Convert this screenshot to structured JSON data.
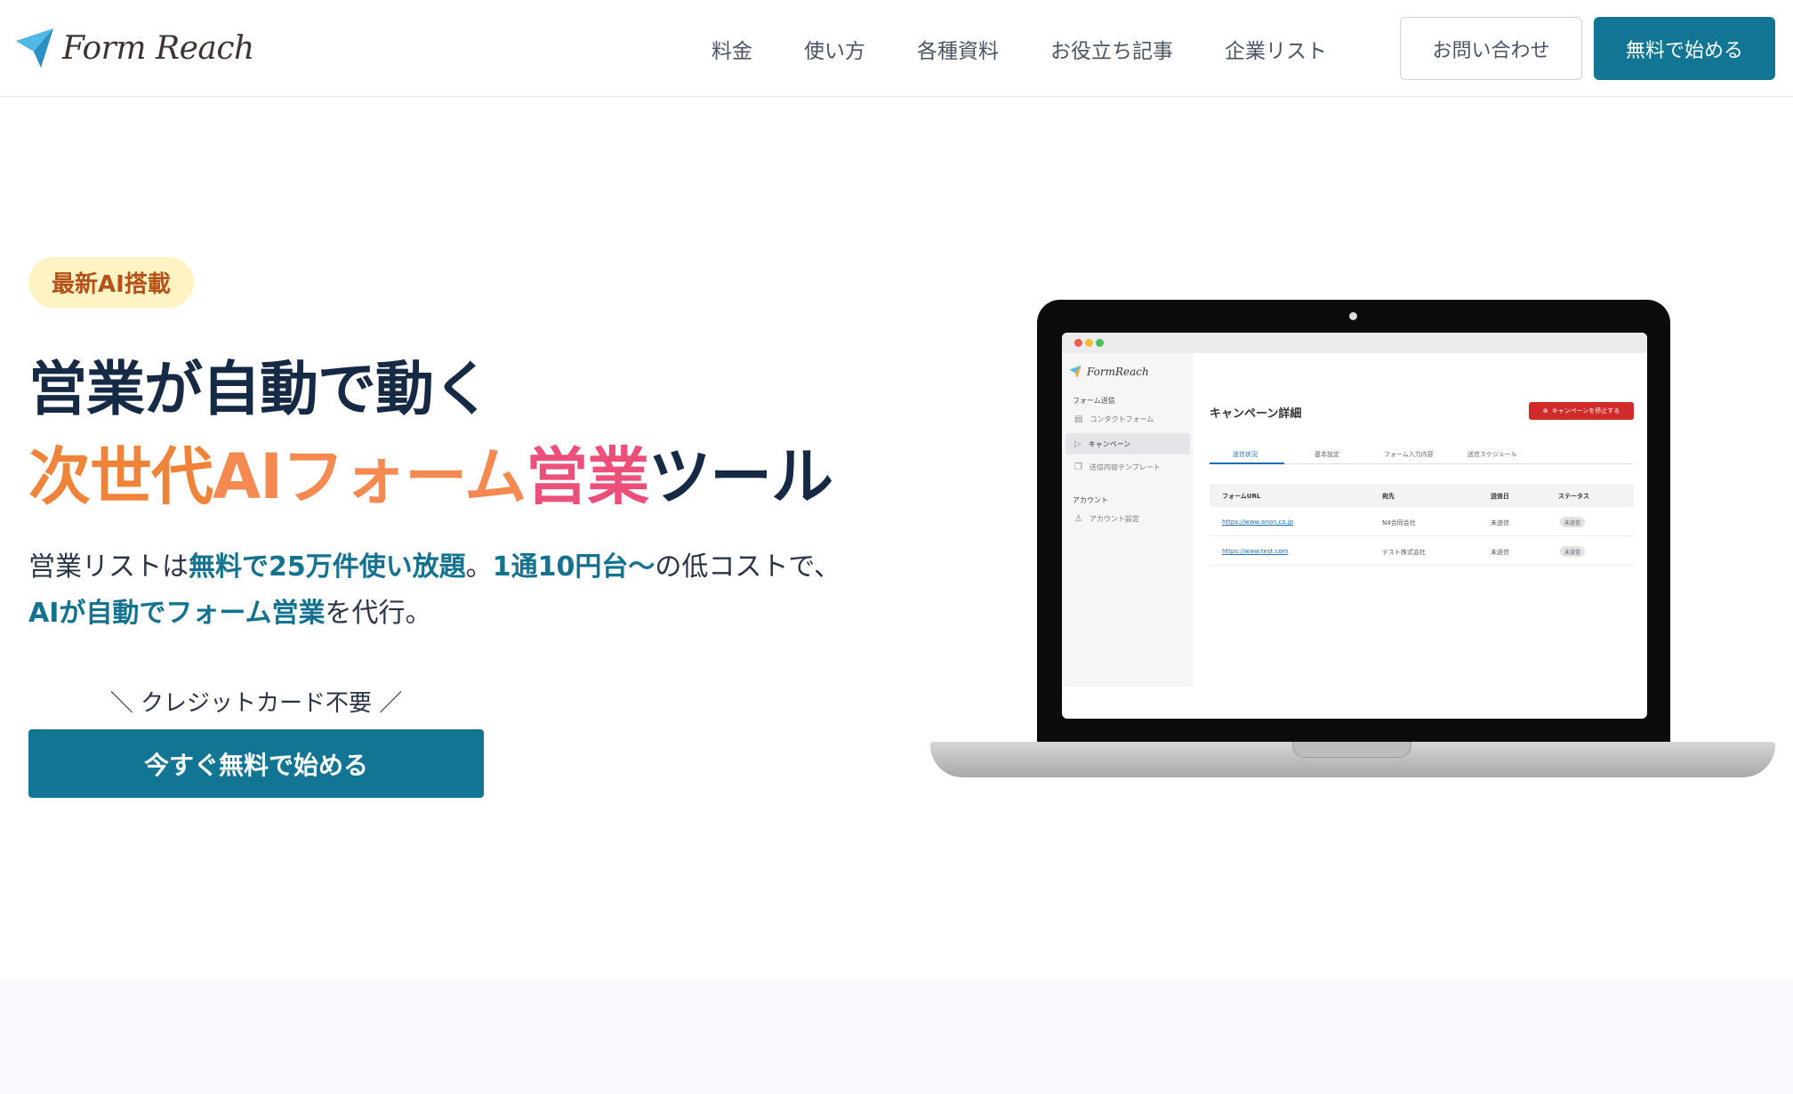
{
  "header": {
    "logo_text": "Form Reach",
    "nav": [
      "料金",
      "使い方",
      "各種資料",
      "お役立ち記事",
      "企業リスト"
    ],
    "contact_label": "お問い合わせ",
    "start_label": "無料で始める"
  },
  "hero": {
    "badge": "最新AI搭載",
    "headline1": "営業が自動で動く",
    "headline2_parts": [
      "次世代",
      "AIフォーム",
      "営業",
      "ツール"
    ],
    "desc_parts": [
      "営業リストは",
      "無料で25万件使い放題",
      "。",
      "1通10円台〜",
      "の低コストで、",
      "AIが自動でフォーム営業",
      "を代行。"
    ],
    "note": "＼ クレジットカード不要 ／",
    "cta_label": "今すぐ無料で始める"
  },
  "app": {
    "logo_text": "FormReach",
    "section1": "フォーム送信",
    "side_items": [
      "コンタクトフォーム",
      "キャンペーン",
      "送信内容テンプレート"
    ],
    "section2": "アカウント",
    "account_item": "アカウント設定",
    "title": "キャンペーン詳細",
    "stop_label": "キャンペーンを停止する",
    "tabs": [
      "送信状況",
      "基本設定",
      "フォーム入力内容",
      "送信スケジュール"
    ],
    "columns": [
      "フォームURL",
      "宛先",
      "送信日",
      "ステータス"
    ],
    "rows": [
      {
        "url": "https://www.anon.co.jp",
        "to": "N4合同会社",
        "date": "未送信",
        "status": "未送信"
      },
      {
        "url": "https://www.test.com",
        "to": "テスト株式会社",
        "date": "未送信",
        "status": "未送信"
      }
    ]
  },
  "colors": {
    "brand": "#127594",
    "badge_bg": "#fff3c4",
    "badge_text": "#b5521a",
    "gradient_orange": "#f0833a",
    "gradient_pink": "#ec4f7a",
    "dark_text": "#172a45"
  },
  "icons": [
    "paper-plane-logo-icon",
    "building-icon",
    "send-icon",
    "document-icon",
    "user-icon",
    "stop-circle-icon"
  ]
}
